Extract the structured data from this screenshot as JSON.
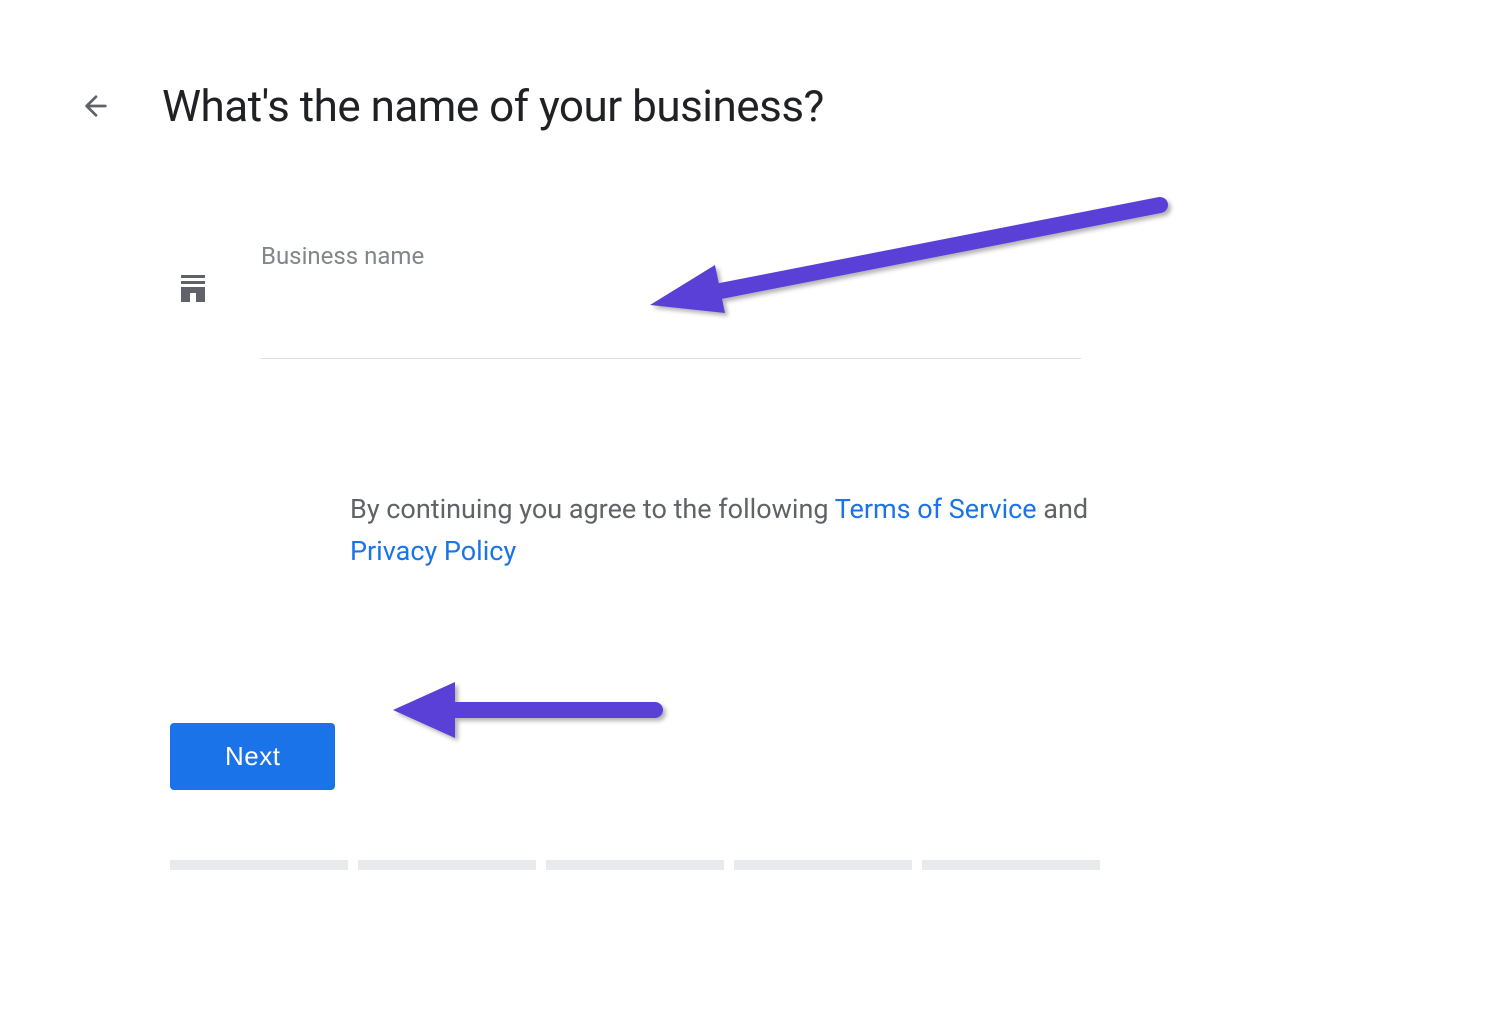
{
  "header": {
    "title": "What's the name of your business?"
  },
  "form": {
    "business_name_label": "Business name",
    "business_name_value": ""
  },
  "terms": {
    "prefix": "By continuing you agree to the following ",
    "tos_label": "Terms of Service",
    "connector": " and ",
    "privacy_label": "Privacy Policy"
  },
  "actions": {
    "next_label": "Next"
  },
  "progress": {
    "segments": 5
  },
  "annotations": {
    "arrow_color": "#5a3fd6"
  }
}
